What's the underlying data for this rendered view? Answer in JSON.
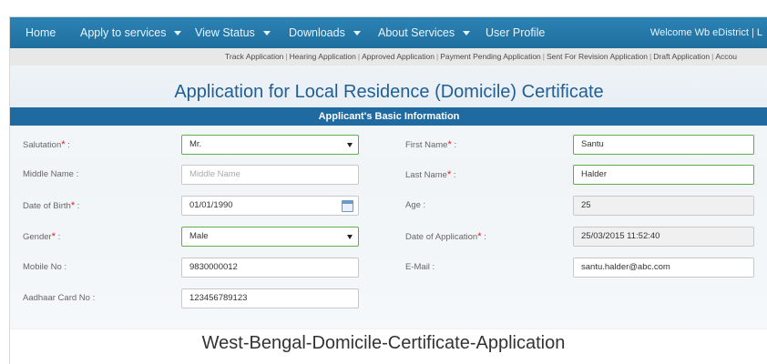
{
  "nav": {
    "items": [
      {
        "label": "Home"
      },
      {
        "label": "Apply to services"
      },
      {
        "label": "View Status"
      },
      {
        "label": "Downloads"
      },
      {
        "label": "About Services"
      },
      {
        "label": "User Profile"
      }
    ],
    "welcome": "Welcome Wb eDistrict | L"
  },
  "subnav": {
    "links": [
      "Track Application",
      "Hearing Application",
      "Approved Application",
      "Payment Pending Application",
      "Sent For Revision Application",
      "Draft Application",
      "Accou"
    ]
  },
  "page": {
    "title": "Application for Local Residence (Domicile) Certificate",
    "section": "Applicant's Basic Information"
  },
  "form": {
    "salutation": {
      "label": "Salutation",
      "value": "Mr."
    },
    "first_name": {
      "label": "First Name",
      "value": "Santu"
    },
    "middle_name": {
      "label": "Middle Name :",
      "placeholder": "Middle Name"
    },
    "last_name": {
      "label": "Last Name",
      "value": "Halder"
    },
    "dob": {
      "label": "Date of Birth",
      "value": "01/01/1990"
    },
    "age": {
      "label": "Age :",
      "value": "25"
    },
    "gender": {
      "label": "Gender",
      "value": "Male"
    },
    "date_of_application": {
      "label": "Date of Application",
      "value": "25/03/2015 11:52:40"
    },
    "mobile": {
      "label": "Mobile No :",
      "value": "9830000012"
    },
    "email": {
      "label": "E-Mail :",
      "value": "santu.halder@abc.com"
    },
    "aadhaar": {
      "label": "Aadhaar Card No :",
      "value": "123456789123"
    },
    "required_mark": "*",
    "colon": " :"
  },
  "caption": "West-Bengal-Domicile-Certificate-Application",
  "colors": {
    "nav_bg": "#1f6f9e",
    "section_bg": "#1f6aa0",
    "title": "#1f5f96",
    "required": "#e02020",
    "valid_border": "#5db14a"
  },
  "icons": {
    "dropdown": "chevron-down-icon",
    "calendar": "calendar-icon"
  }
}
